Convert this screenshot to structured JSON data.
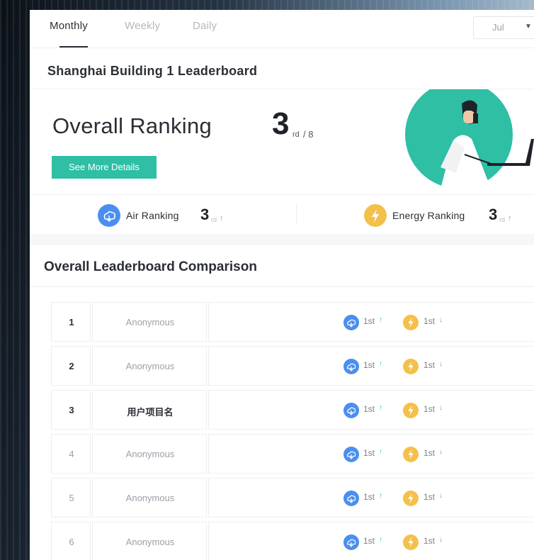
{
  "tabs": [
    {
      "label": "Monthly",
      "active": true
    },
    {
      "label": "Weekly",
      "active": false
    },
    {
      "label": "Daily",
      "active": false
    }
  ],
  "month_select": {
    "value": "Jul"
  },
  "leaderboard": {
    "title": "Shanghai Building 1 Leaderboard"
  },
  "overall": {
    "label": "Overall Ranking",
    "rank": "3",
    "suffix": "rd",
    "total": "/ 8",
    "details_button": "See More Details"
  },
  "sub_rankings": [
    {
      "label": "Air Ranking",
      "rank": "3",
      "suffix": "rd",
      "trend": "up",
      "icon": "air-cloud-icon",
      "color": "#4a8ff0"
    },
    {
      "label": "Energy Ranking",
      "rank": "3",
      "suffix": "rd",
      "trend": "up",
      "icon": "lightning-bolt-icon",
      "color": "#f5c04a"
    }
  ],
  "comparison": {
    "title": "Overall Leaderboard Comparison",
    "rows": [
      {
        "rank": "1",
        "name": "Anonymous",
        "air": "1st",
        "energy": "1st"
      },
      {
        "rank": "2",
        "name": "Anonymous",
        "air": "1st",
        "energy": "1st"
      },
      {
        "rank": "3",
        "name": "用户项目名",
        "air": "1st",
        "energy": "1st"
      },
      {
        "rank": "4",
        "name": "Anonymous",
        "air": "1st",
        "energy": "1st"
      },
      {
        "rank": "5",
        "name": "Anonymous",
        "air": "1st",
        "energy": "1st"
      },
      {
        "rank": "6",
        "name": "Anonymous",
        "air": "1st",
        "energy": "1st"
      }
    ]
  },
  "colors": {
    "accent": "#2ebfa5",
    "air": "#4a8ff0",
    "energy": "#f5c04a",
    "up": "#2ebfa5",
    "down": "#e86a6a"
  }
}
